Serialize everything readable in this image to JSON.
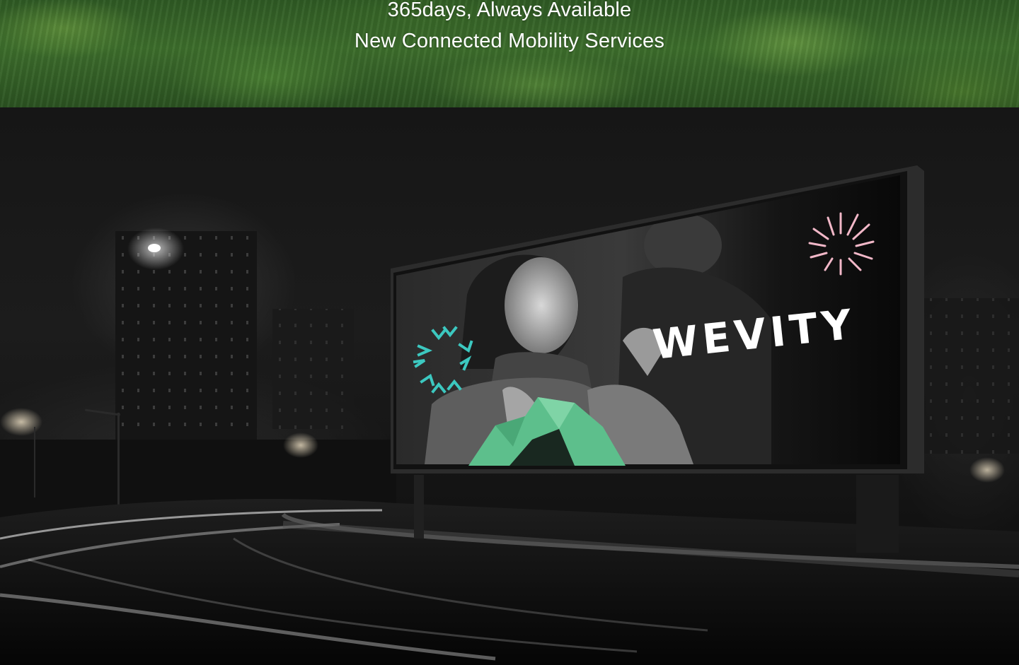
{
  "hero": {
    "line1": "365days, Always Available",
    "line2": "New Connected Mobility Services"
  },
  "billboard": {
    "brand": "WEVITY"
  },
  "colors": {
    "accent_teal": "#3cc8c0",
    "accent_green": "#5dbf8c",
    "accent_pink": "#f2b8c8"
  },
  "icons": {
    "teal_mark": "arrow-burst-icon",
    "pink_mark": "sunburst-icon",
    "green_mark": "geometric-mountain-icon"
  }
}
